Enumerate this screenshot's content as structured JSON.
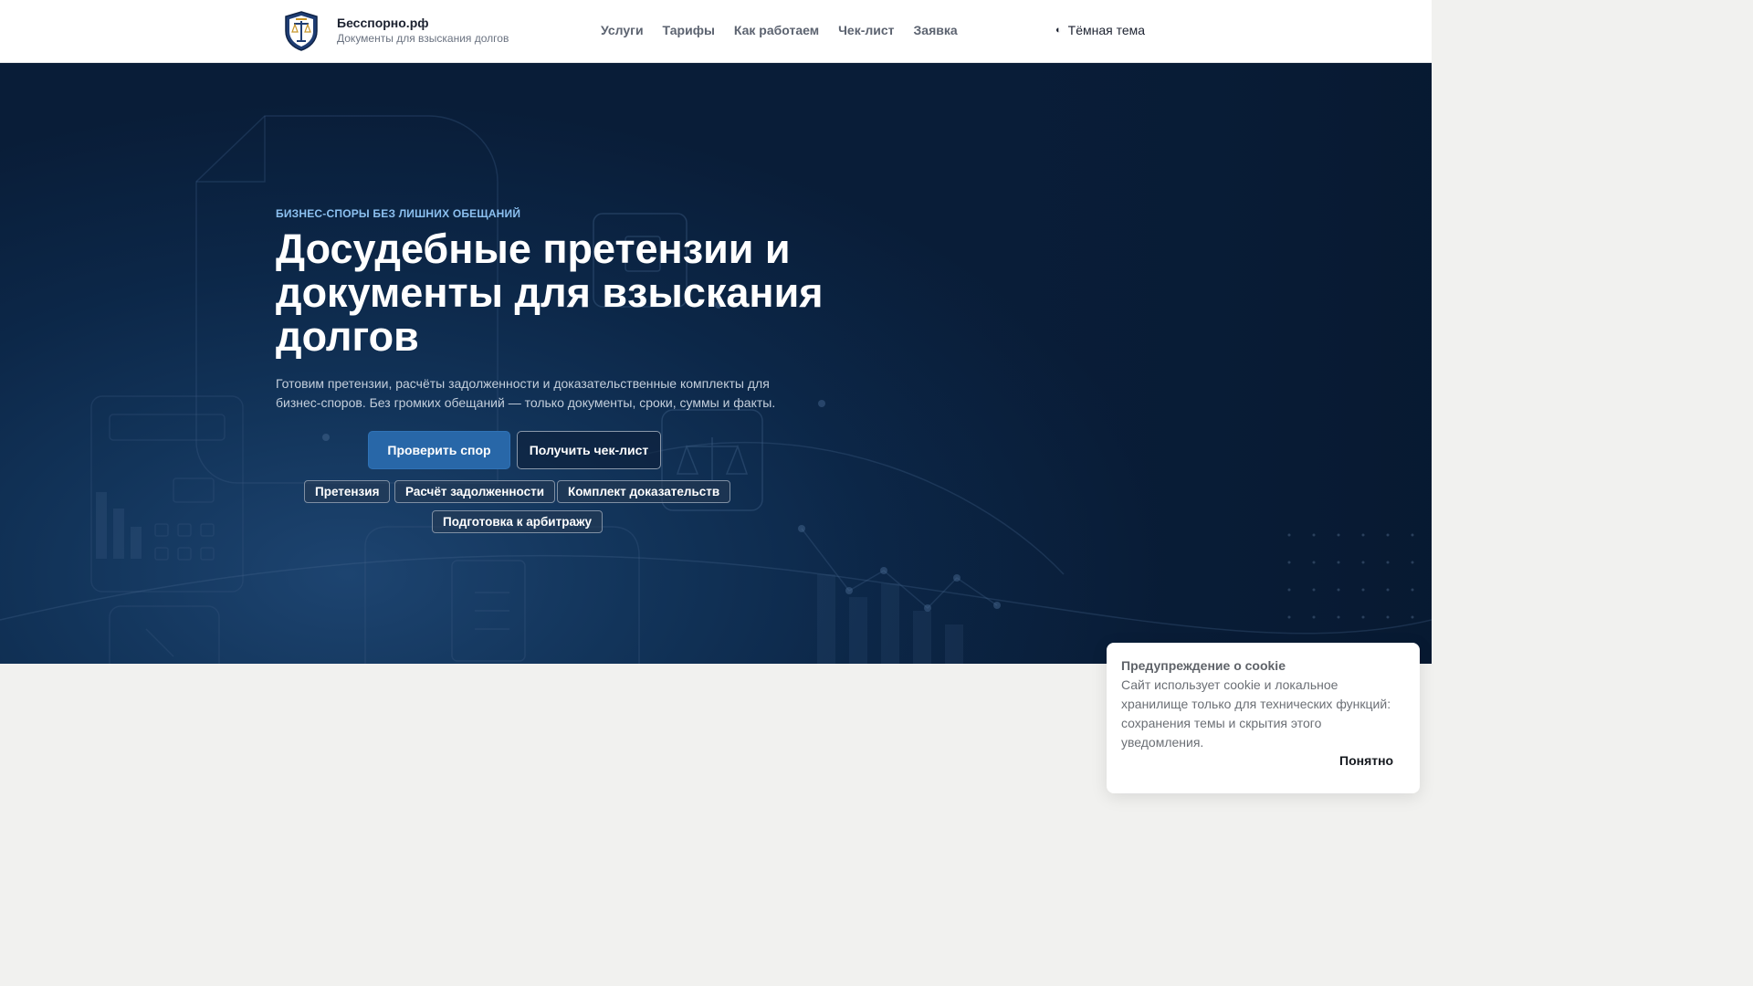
{
  "header": {
    "brand_name": "Бесспорно.рф",
    "brand_tagline": "Документы для взыскания долгов",
    "nav": [
      "Услуги",
      "Тарифы",
      "Как работаем",
      "Чек-лист",
      "Заявка"
    ],
    "theme_toggle_icon": "◐",
    "theme_toggle_label": "Тёмная тема"
  },
  "hero": {
    "eyebrow": "БИЗНЕС-СПОРЫ БЕЗ ЛИШНИХ ОБЕЩАНИЙ",
    "headline": "Досудебные претензии и документы для взыскания долгов",
    "lead": "Готовим претензии, расчёты задолженности и доказательственные комплекты для бизнес-споров. Без громких обещаний — только документы, сроки, суммы и факты.",
    "primary_cta": "Проверить спор",
    "secondary_cta": "Получить чек-лист",
    "chips": [
      "Претензия",
      "Расчёт задолженности",
      "Комплект доказательств",
      "Подготовка к арбитражу"
    ]
  },
  "cookie": {
    "title": "Предупреждение о cookie",
    "text": "Сайт использует cookie и локальное хранилище только для технических функций: сохранения темы и скрытия этого уведомления.",
    "accept_label": "Понятно"
  },
  "colors": {
    "accent": "#2867a8",
    "hero_dark": "#091d38",
    "eyebrow": "#8cc0f0"
  }
}
